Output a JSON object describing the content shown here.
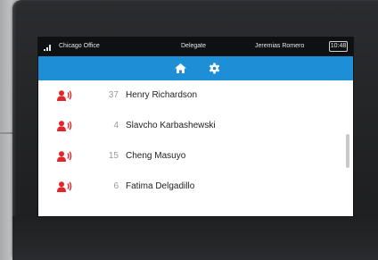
{
  "status_bar": {
    "location": "Chicago Office",
    "role": "Delegate",
    "user": "Jeremias Romero",
    "time": "10:48"
  },
  "nav": {
    "tabs": [
      {
        "icon": "home-icon",
        "active": true
      },
      {
        "icon": "gear-icon",
        "active": false
      }
    ]
  },
  "colors": {
    "nav_bar": "#1e8fd6",
    "speaker_icon": "#e0262b",
    "status_bar": "#0f1013"
  },
  "list": {
    "items": [
      {
        "count": "37",
        "name": "Henry Richardson",
        "icon": "speaker-person-icon"
      },
      {
        "count": "4",
        "name": "Slavcho Karbashewski",
        "icon": "speaker-person-icon"
      },
      {
        "count": "15",
        "name": "Cheng Masuyo",
        "icon": "speaker-person-icon"
      },
      {
        "count": "6",
        "name": "Fatima Delgadillo",
        "icon": "speaker-person-icon"
      }
    ]
  }
}
